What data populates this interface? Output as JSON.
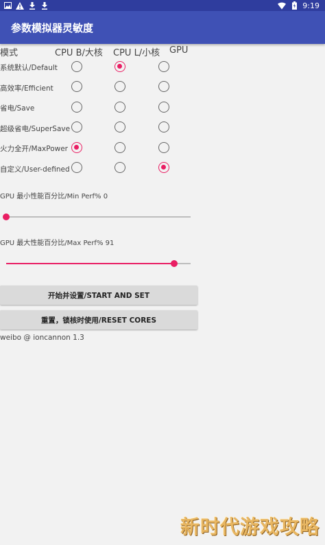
{
  "status_bar": {
    "icons_left": [
      "image-icon",
      "warning-icon",
      "download-icon",
      "download-icon"
    ],
    "icons_right": [
      "wifi-icon",
      "battery-icon"
    ],
    "time": "9:19"
  },
  "app": {
    "title": "参数模拟器灵敏度"
  },
  "table": {
    "headers": {
      "mode": "模式",
      "cpu_big": "CPU B/大核",
      "cpu_little": "CPU L/小核",
      "gpu": "GPU"
    },
    "rows": [
      {
        "label": "系统默认/Default",
        "cpu_big": false,
        "cpu_little": true,
        "gpu": false
      },
      {
        "label": "高效率/Efficient",
        "cpu_big": false,
        "cpu_little": false,
        "gpu": false
      },
      {
        "label": "省电/Save",
        "cpu_big": false,
        "cpu_little": false,
        "gpu": false
      },
      {
        "label": "超级省电/SuperSave",
        "cpu_big": false,
        "cpu_little": false,
        "gpu": false
      },
      {
        "label": "火力全开/MaxPower",
        "cpu_big": true,
        "cpu_little": false,
        "gpu": false
      },
      {
        "label": "自定义/User-defined",
        "cpu_big": false,
        "cpu_little": false,
        "gpu": true
      }
    ]
  },
  "gpu_min": {
    "label": "GPU 最小性能百分比/Min Perf% 0",
    "value": 0
  },
  "gpu_max": {
    "label": "GPU 最大性能百分比/Max Perf% 91",
    "value": 91
  },
  "buttons": {
    "start": "开始并设置/START AND SET",
    "reset": "重置，锁核时使用/RESET CORES"
  },
  "footer": "weibo @ ioncannon 1.3",
  "watermark": "新时代游戏攻略",
  "colors": {
    "primary": "#3f51b5",
    "status_bar": "#2f3d9e",
    "accent": "#e91e63"
  }
}
